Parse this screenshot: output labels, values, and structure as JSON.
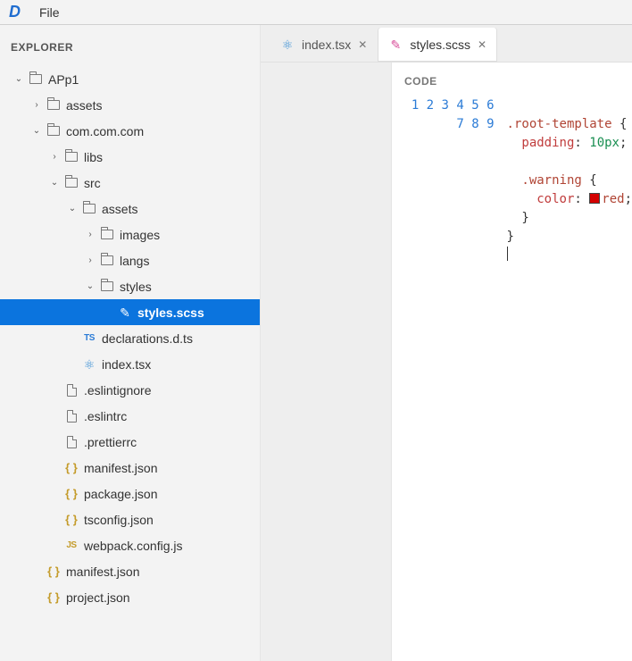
{
  "menubar": {
    "logo": "D",
    "file": "File"
  },
  "sidebar": {
    "header": "EXPLORER",
    "tree": [
      {
        "depth": 0,
        "chev": "down",
        "icon": "folder",
        "label": "APp1",
        "interact": true
      },
      {
        "depth": 1,
        "chev": "right",
        "icon": "folder",
        "label": "assets",
        "interact": true
      },
      {
        "depth": 1,
        "chev": "down",
        "icon": "folder",
        "label": "com.com.com",
        "interact": true
      },
      {
        "depth": 2,
        "chev": "right",
        "icon": "folder",
        "label": "libs",
        "interact": true
      },
      {
        "depth": 2,
        "chev": "down",
        "icon": "folder",
        "label": "src",
        "interact": true
      },
      {
        "depth": 3,
        "chev": "down",
        "icon": "folder",
        "label": "assets",
        "interact": true
      },
      {
        "depth": 4,
        "chev": "right",
        "icon": "folder",
        "label": "images",
        "interact": true
      },
      {
        "depth": 4,
        "chev": "right",
        "icon": "folder",
        "label": "langs",
        "interact": true
      },
      {
        "depth": 4,
        "chev": "down",
        "icon": "folder",
        "label": "styles",
        "interact": true
      },
      {
        "depth": 5,
        "chev": "blank",
        "icon": "scss",
        "label": "styles.scss",
        "interact": true,
        "selected": true
      },
      {
        "depth": 3,
        "chev": "blank",
        "icon": "ts",
        "label": "declarations.d.ts",
        "interact": true
      },
      {
        "depth": 3,
        "chev": "blank",
        "icon": "react",
        "label": "index.tsx",
        "interact": true
      },
      {
        "depth": 2,
        "chev": "blank",
        "icon": "file",
        "label": ".eslintignore",
        "interact": true
      },
      {
        "depth": 2,
        "chev": "blank",
        "icon": "file",
        "label": ".eslintrc",
        "interact": true
      },
      {
        "depth": 2,
        "chev": "blank",
        "icon": "file",
        "label": ".prettierrc",
        "interact": true
      },
      {
        "depth": 2,
        "chev": "blank",
        "icon": "json",
        "label": "manifest.json",
        "interact": true
      },
      {
        "depth": 2,
        "chev": "blank",
        "icon": "json",
        "label": "package.json",
        "interact": true
      },
      {
        "depth": 2,
        "chev": "blank",
        "icon": "json",
        "label": "tsconfig.json",
        "interact": true
      },
      {
        "depth": 2,
        "chev": "blank",
        "icon": "js",
        "label": "webpack.config.js",
        "interact": true
      },
      {
        "depth": 1,
        "chev": "blank",
        "icon": "json",
        "label": "manifest.json",
        "interact": true
      },
      {
        "depth": 1,
        "chev": "blank",
        "icon": "json",
        "label": "project.json",
        "interact": true
      }
    ]
  },
  "tabs": [
    {
      "icon": "react",
      "label": "index.tsx",
      "active": false
    },
    {
      "icon": "scss",
      "label": "styles.scss",
      "active": true
    }
  ],
  "editor": {
    "header": "CODE",
    "line_count": 9,
    "raw_lines": [
      ".root-template {",
      "  padding: 10px;",
      "",
      "  .warning {",
      "    color: ▢ red;",
      "  }",
      "}",
      "",
      ""
    ],
    "tokens": {
      "l1_sel": ".root-template",
      "l1_brace": " {",
      "l2_prop": "padding",
      "l2_val": "10",
      "l2_unit": "px",
      "l4_sel": ".warning",
      "l4_brace": " {",
      "l5_prop": "color",
      "l5_val": "red",
      "l6_brace": "}",
      "l7_brace": "}"
    }
  }
}
